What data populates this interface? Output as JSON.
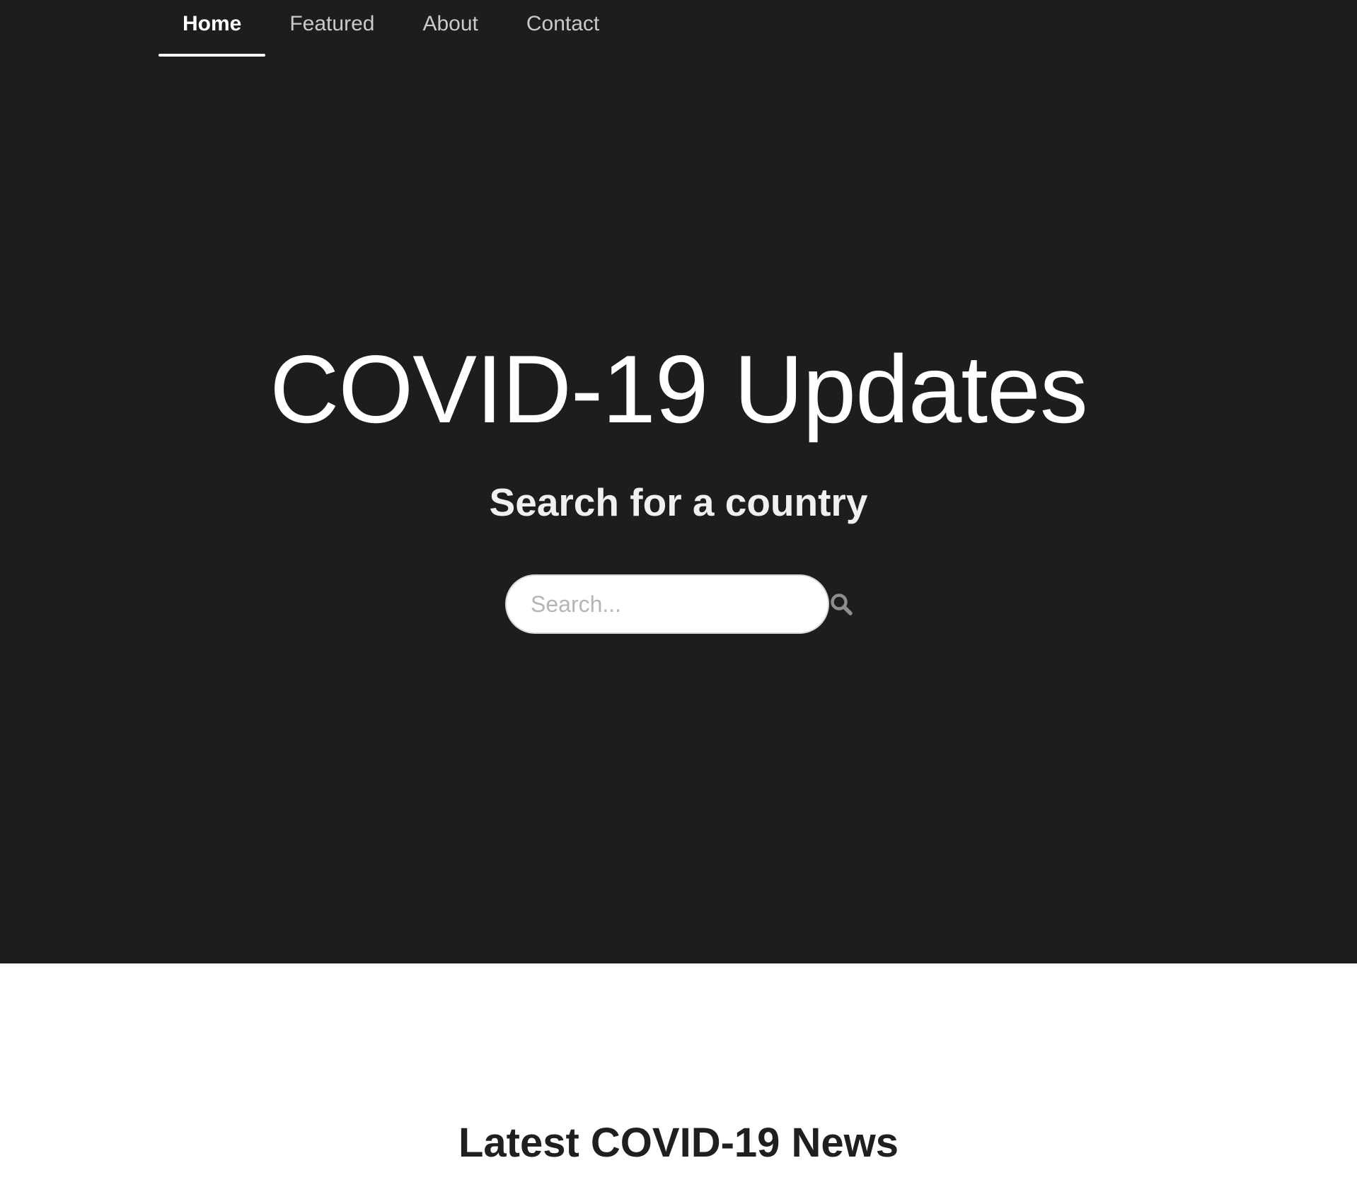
{
  "nav": {
    "items": [
      {
        "label": "Home",
        "active": true
      },
      {
        "label": "Featured",
        "active": false
      },
      {
        "label": "About",
        "active": false
      },
      {
        "label": "Contact",
        "active": false
      }
    ]
  },
  "hero": {
    "title": "COVID-19 Updates",
    "subtitle": "Search for a country",
    "search": {
      "placeholder": "Search...",
      "value": "",
      "icon": "search-icon"
    }
  },
  "news": {
    "heading": "Latest COVID-19 News"
  },
  "colors": {
    "hero_background": "#1c1d1f",
    "nav_active": "#ffffff",
    "nav_inactive": "#c9cacc",
    "page_background": "#ffffff",
    "heading_dark": "#1f1f21"
  }
}
